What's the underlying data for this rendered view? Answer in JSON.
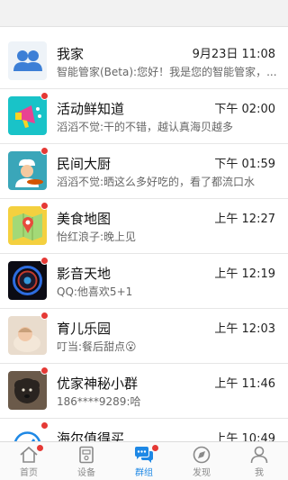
{
  "chats": [
    {
      "name": "我家",
      "time": "9月23日 11:08",
      "message": "智能管家(Beta):您好！我是您的智能管家，...",
      "unread": false,
      "icon": "family-group-icon"
    },
    {
      "name": "活动鲜知道",
      "time": "下午 02:00",
      "message": "滔滔不觉:干的不错，越认真海贝越多",
      "unread": true,
      "icon": "megaphone-icon"
    },
    {
      "name": "民间大厨",
      "time": "下午 01:59",
      "message": "滔滔不觉:晒这么多好吃的，看了都流口水",
      "unread": true,
      "icon": "chef-icon"
    },
    {
      "name": "美食地图",
      "time": "上午 12:27",
      "message": "怡红浪子:晚上见",
      "unread": true,
      "icon": "food-map-icon"
    },
    {
      "name": "影音天地",
      "time": "上午 12:19",
      "message": "QQ:他喜欢5+1",
      "unread": true,
      "icon": "speaker-icon"
    },
    {
      "name": "育儿乐园",
      "time": "上午 12:03",
      "message": "叮当:餐后甜点😮",
      "unread": true,
      "icon": "baby-photo"
    },
    {
      "name": "优家神秘小群",
      "time": "上午 11:46",
      "message": "186****9289:哈",
      "unread": true,
      "icon": "dog-photo"
    },
    {
      "name": "海尔值得买",
      "time": "上午 10:49",
      "message": "",
      "unread": true,
      "icon": "haier-icon"
    }
  ],
  "tabs": [
    {
      "label": "首页",
      "icon": "home-icon",
      "active": false,
      "badge": true
    },
    {
      "label": "设备",
      "icon": "device-icon",
      "active": false,
      "badge": false
    },
    {
      "label": "群组",
      "icon": "chat-bubbles-icon",
      "active": true,
      "badge": true
    },
    {
      "label": "发现",
      "icon": "compass-icon",
      "active": false,
      "badge": false
    },
    {
      "label": "我",
      "icon": "person-icon",
      "active": false,
      "badge": false
    }
  ],
  "colors": {
    "accent": "#1e88e5",
    "badge": "#e53935"
  }
}
